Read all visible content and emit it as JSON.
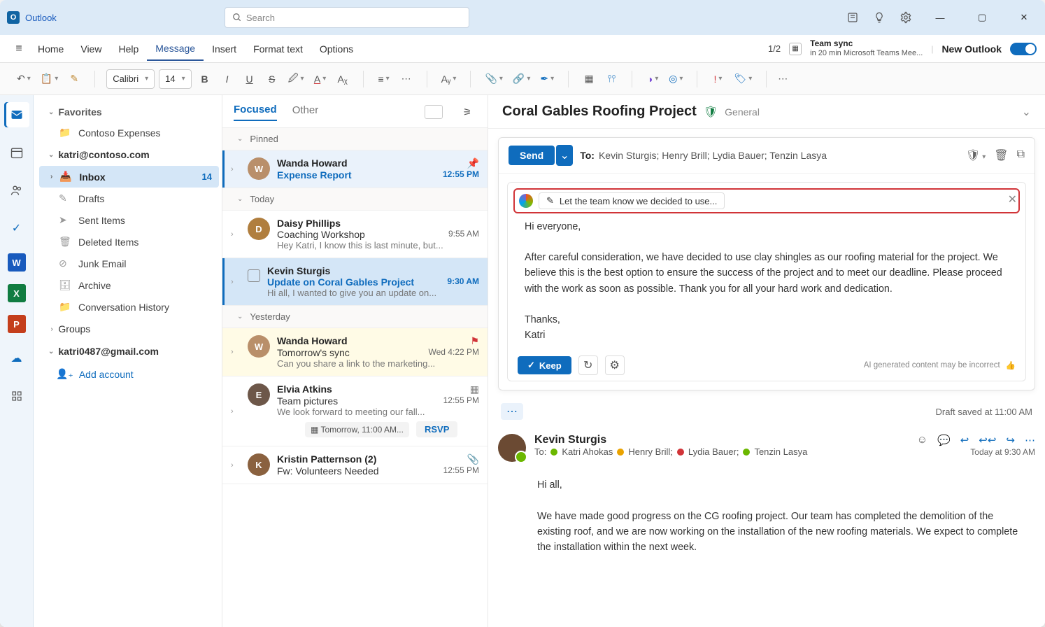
{
  "app": {
    "name": "Outlook",
    "search_placeholder": "Search"
  },
  "window": {
    "minimize": "—",
    "maximize": "▢",
    "close": "✕"
  },
  "menubar": {
    "items": [
      "Home",
      "View",
      "Help",
      "Message",
      "Insert",
      "Format text",
      "Options"
    ],
    "counter": "1/2",
    "teamsync_title": "Team sync",
    "teamsync_sub": "in 20 min Microsoft Teams Mee...",
    "new_outlook": "New Outlook"
  },
  "ribbon": {
    "font_name": "Calibri",
    "font_size": "14"
  },
  "favorites": {
    "header": "Favorites",
    "items": [
      "Contoso Expenses"
    ]
  },
  "account1": {
    "name": "katri@contoso.com",
    "folders": [
      {
        "name": "Inbox",
        "count": "14"
      },
      {
        "name": "Drafts"
      },
      {
        "name": "Sent Items"
      },
      {
        "name": "Deleted Items"
      },
      {
        "name": "Junk Email"
      },
      {
        "name": "Archive"
      },
      {
        "name": "Conversation History"
      }
    ],
    "groups": "Groups"
  },
  "account2": {
    "name": "katri0487@gmail.com"
  },
  "add_account": "Add account",
  "list_tabs": {
    "focused": "Focused",
    "other": "Other"
  },
  "groups_labels": {
    "pinned": "Pinned",
    "today": "Today",
    "yesterday": "Yesterday"
  },
  "messages": [
    {
      "sender": "Wanda Howard",
      "subject": "Expense Report",
      "time": "12:55 PM",
      "pin": true
    },
    {
      "sender": "Daisy Phillips",
      "subject": "Coaching Workshop",
      "preview": "Hey Katri, I know this is last minute, but...",
      "time": "9:55 AM"
    },
    {
      "sender": "Kevin Sturgis",
      "subject": "Update on Coral Gables Project",
      "preview": "Hi all, I wanted to give you an update on...",
      "time": "9:30 AM"
    },
    {
      "sender": "Wanda Howard",
      "subject": "Tomorrow's sync",
      "preview": "Can you share a link to the marketing...",
      "time": "Wed 4:22 PM",
      "flagged": true
    },
    {
      "sender": "Elvia Atkins",
      "subject": "Team pictures",
      "preview": "We look forward to meeting our fall...",
      "time": "12:55 PM",
      "rsvp_time": "Tomorrow, 11:00 AM...",
      "rsvp": "RSVP"
    },
    {
      "sender": "Kristin Patternson (2)",
      "subject": "Fw: Volunteers Needed",
      "preview": "",
      "time": "12:55 PM"
    }
  ],
  "reading": {
    "title": "Coral Gables Roofing Project",
    "category": "General",
    "send": "Send",
    "to_label": "To:",
    "to_line": "Kevin Sturgis; Henry Brill; Lydia Bauer; Tenzin Lasya",
    "copilot_prompt": "Let the team know we decided to use...",
    "body_greeting": "Hi everyone,",
    "body_main": "After careful consideration, we have decided to use clay shingles as our roofing material for the project. We believe this is the best option to ensure the success of the project and to meet our deadline. Please proceed with the work as soon as possible.  Thank you for all your hard work and dedication.",
    "body_thanks": "Thanks,",
    "body_sign": "Katri",
    "keep": "Keep",
    "ai_note": "AI generated content may be incorrect",
    "draft_saved": "Draft saved at 11:00 AM"
  },
  "thread": {
    "sender": "Kevin Sturgis",
    "to_label": "To:",
    "recipients": [
      {
        "name": "Katri Ahokas",
        "color": "#6bb700"
      },
      {
        "name": "Henry Brill;",
        "color": "#eaa300"
      },
      {
        "name": "Lydia Bauer;",
        "color": "#d13438"
      },
      {
        "name": "Tenzin Lasya",
        "color": "#6bb700"
      }
    ],
    "time": "Today at 9:30 AM",
    "greeting": "Hi all,",
    "body": "We have made good progress on the CG roofing project. Our team has completed the demolition of the existing roof, and we are now working on the installation of the new roofing materials. We expect to complete the installation within the next week."
  }
}
